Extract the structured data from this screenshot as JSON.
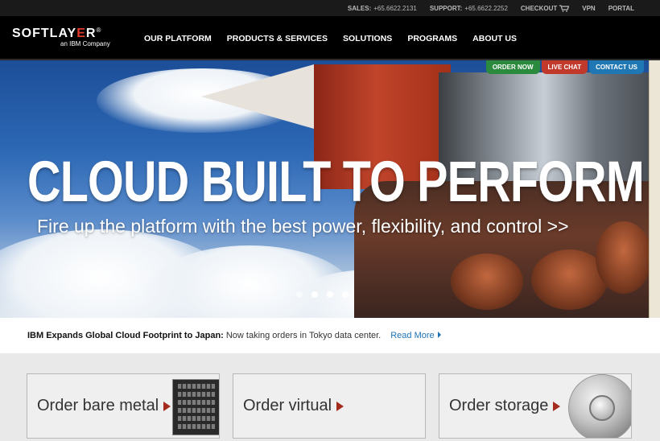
{
  "utility_bar": {
    "sales_label": "SALES:",
    "sales_number": "+65.6622.2131",
    "support_label": "SUPPORT:",
    "support_number": "+65.6622.2252",
    "checkout": "CHECKOUT",
    "vpn": "VPN",
    "portal": "PORTAL"
  },
  "brand": {
    "logo_text_prefix": "SOFTLAY",
    "logo_text_accent": "E",
    "logo_text_suffix": "R",
    "trademark": "®",
    "tagline": "an IBM Company"
  },
  "main_nav": {
    "items": [
      "OUR PLATFORM",
      "PRODUCTS & SERVICES",
      "SOLUTIONS",
      "PROGRAMS",
      "ABOUT US"
    ]
  },
  "hero": {
    "title": "CLOUD BUILT TO PERFORM",
    "subtitle": "Fire up the platform with the best power, flexibility, and control >>",
    "tabs": {
      "order_now": "ORDER NOW",
      "live_chat": "LIVE CHAT",
      "contact_us": "CONTACT US"
    },
    "slide_count": 4,
    "active_slide": 2
  },
  "news": {
    "headline": "IBM Expands Global Cloud Footprint to Japan:",
    "body": "Now taking orders in Tokyo data center.",
    "link": "Read More"
  },
  "cards": [
    {
      "label": "Order bare metal",
      "icon": "server-rack-icon"
    },
    {
      "label": "Order virtual",
      "icon": ""
    },
    {
      "label": "Order storage",
      "icon": "vault-icon"
    }
  ],
  "colors": {
    "accent_red": "#a32a1c",
    "order_now": "#2b8a3e",
    "live_chat": "#c0392b",
    "contact_us": "#1f77b4",
    "link_blue": "#1f73b7"
  }
}
